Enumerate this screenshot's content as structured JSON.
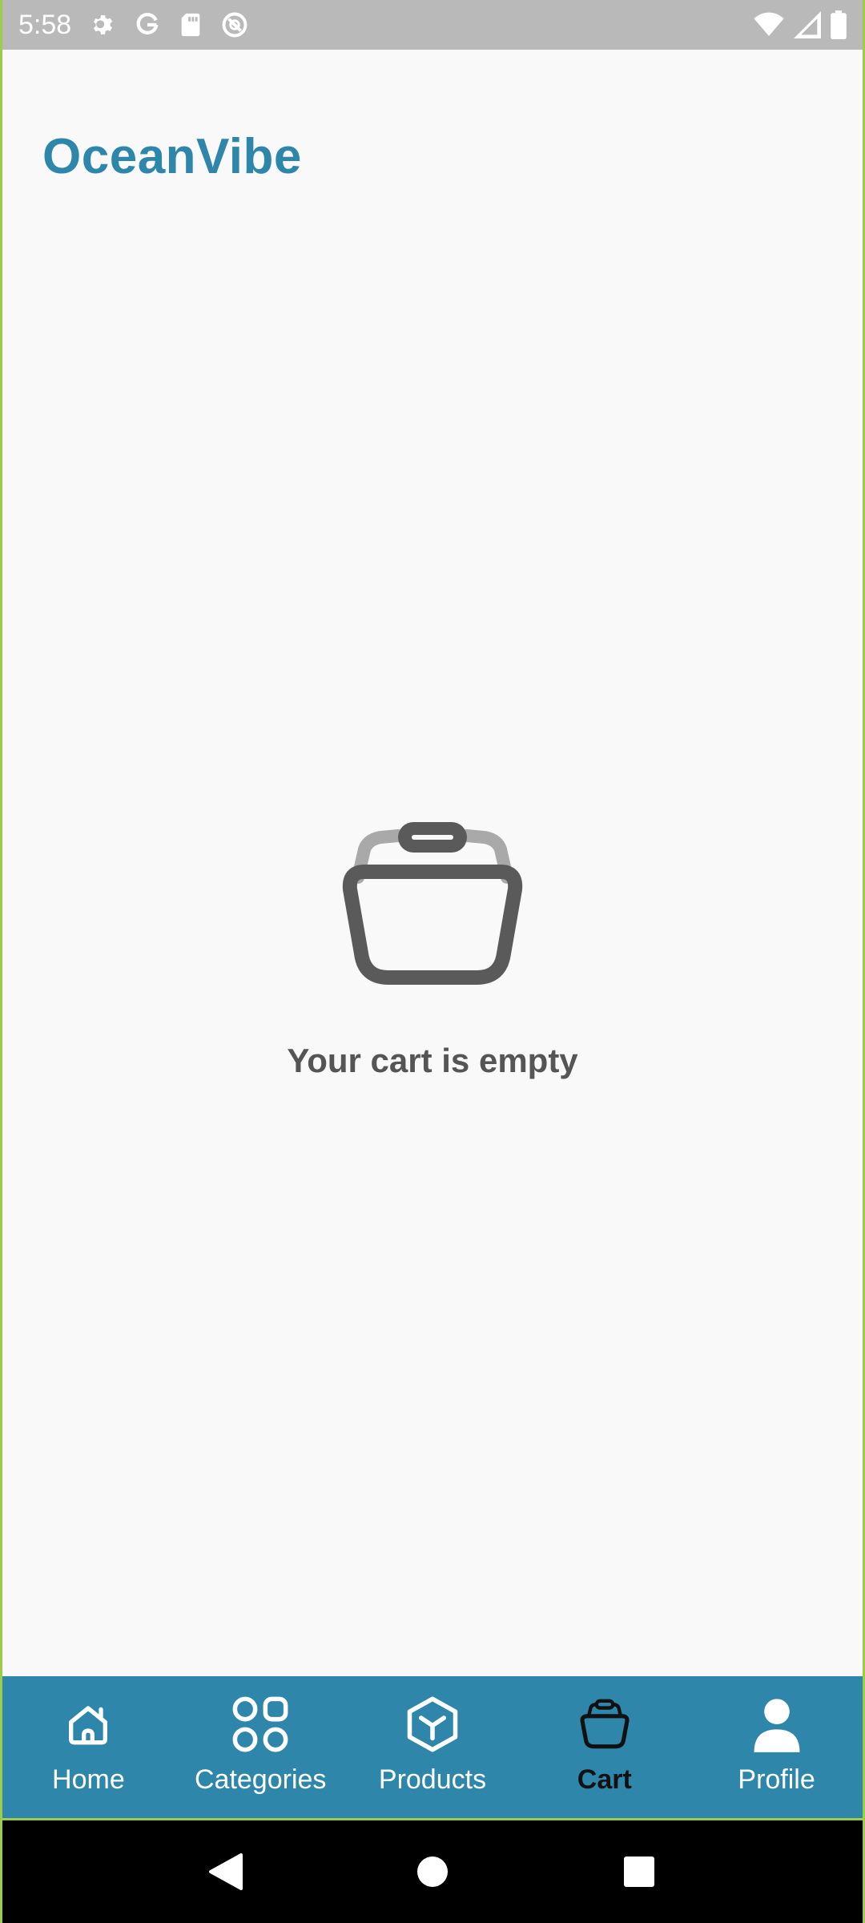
{
  "status_bar": {
    "time": "5:58",
    "left_icons": [
      "gear-icon",
      "google-icon",
      "sd-card-icon",
      "do-not-disturb-icon"
    ],
    "right_icons": [
      "wifi-icon",
      "signal-icon",
      "battery-icon"
    ]
  },
  "header": {
    "app_title": "OceanVibe"
  },
  "empty_state": {
    "icon": "basket-icon",
    "message": "Your cart is empty"
  },
  "bottom_nav": {
    "items": [
      {
        "label": "Home",
        "icon": "home-icon",
        "active": false
      },
      {
        "label": "Categories",
        "icon": "grid-icon",
        "active": false
      },
      {
        "label": "Products",
        "icon": "box-icon",
        "active": false
      },
      {
        "label": "Cart",
        "icon": "basket-icon",
        "active": true
      },
      {
        "label": "Profile",
        "icon": "person-icon",
        "active": false
      }
    ]
  },
  "system_nav": {
    "buttons": [
      "back-icon",
      "home-circle-icon",
      "recents-icon"
    ]
  },
  "colors": {
    "brand": "#2e86ab",
    "text_muted": "#555555",
    "active_nav": "#111111",
    "status_bar": "#b9b9b9"
  }
}
